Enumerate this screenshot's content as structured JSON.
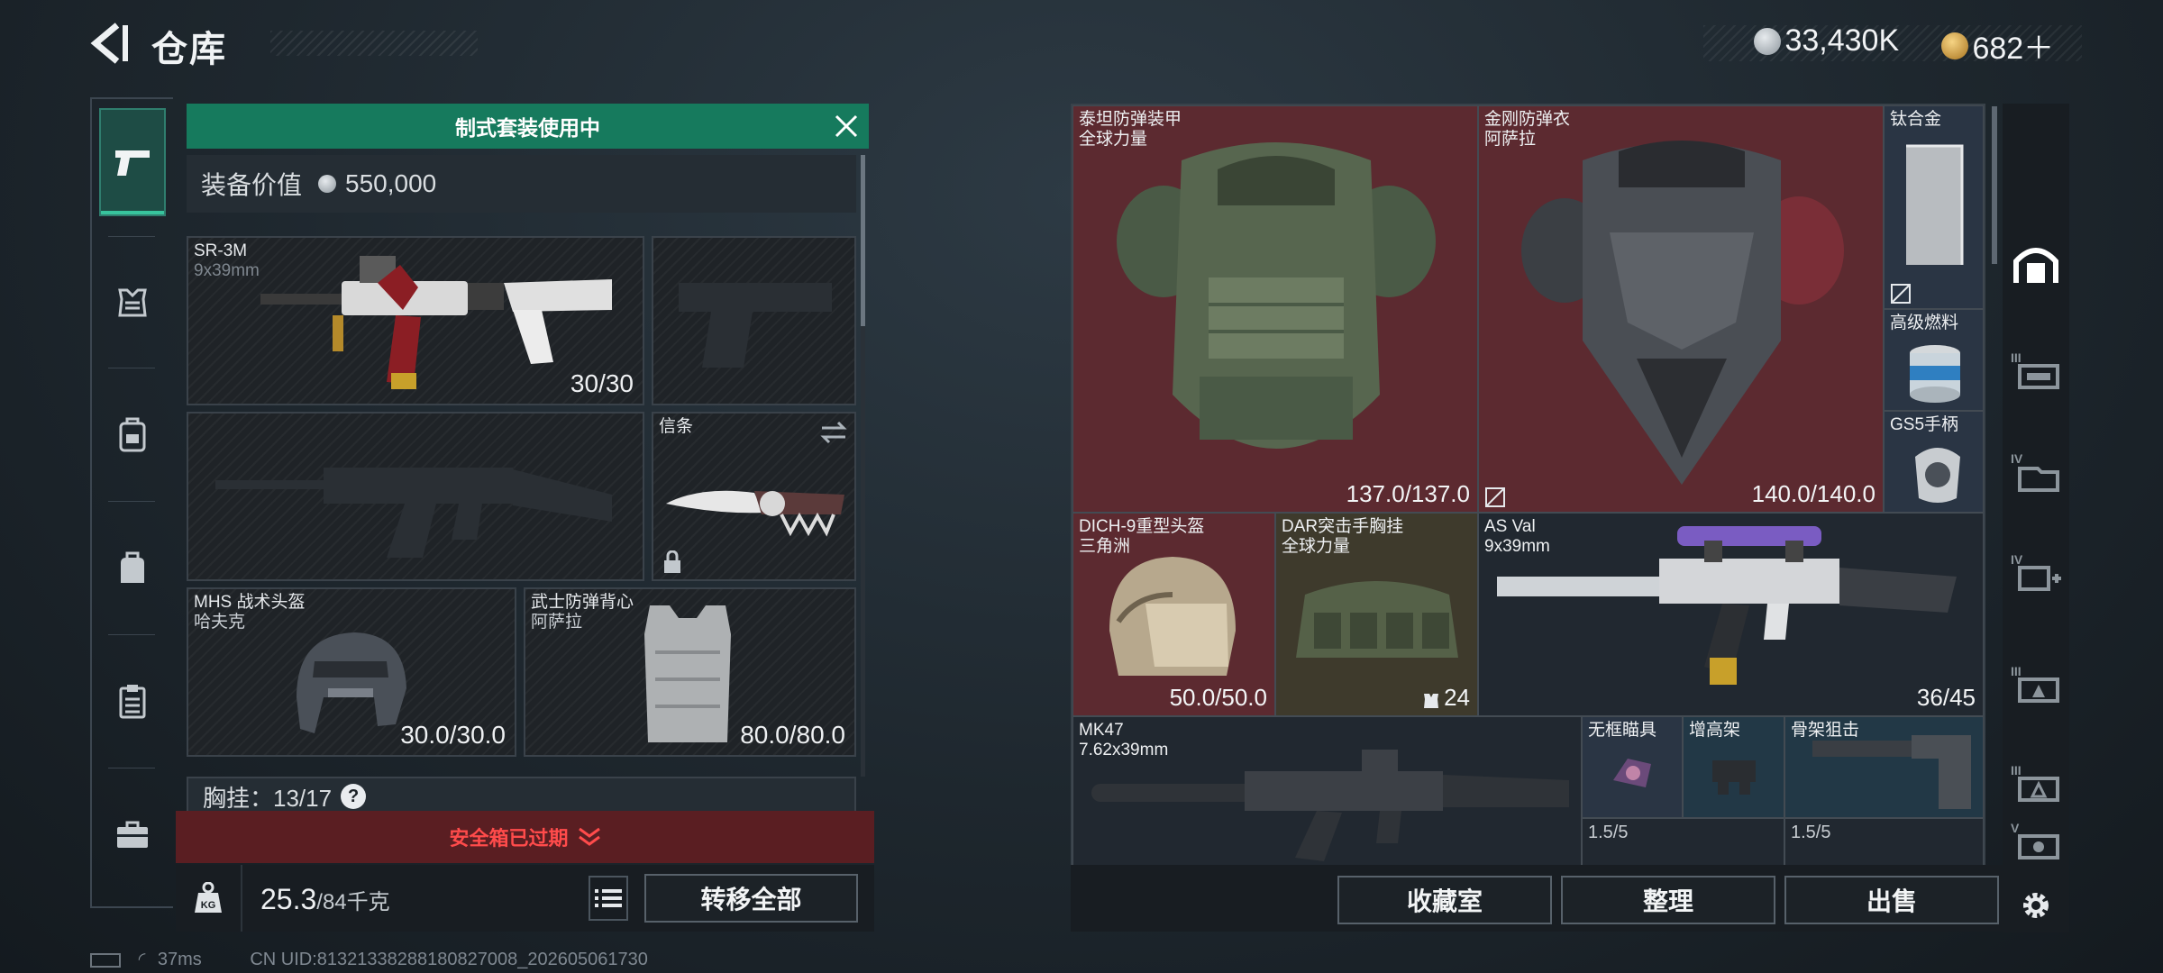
{
  "header": {
    "title": "仓库",
    "currency": [
      {
        "icon": "silver-coin-icon",
        "amount": "33,430K",
        "color": "#b9c0c6"
      },
      {
        "icon": "gold-coin-icon",
        "amount": "682＋",
        "color": "#d7a24a"
      }
    ]
  },
  "left_tabs": [
    {
      "icon": "pistol-icon"
    },
    {
      "icon": "armor-icon"
    },
    {
      "icon": "backpack-icon"
    },
    {
      "icon": "bag-icon"
    },
    {
      "icon": "clipboard-icon"
    },
    {
      "icon": "briefcase-icon"
    }
  ],
  "loadout": {
    "banner": "制式套装使用中",
    "value_label": "装备价值",
    "value": "550,000",
    "primary": {
      "name": "SR-3M",
      "ammo": "9x39mm",
      "count": "30/30"
    },
    "melee": {
      "name": "信条"
    },
    "helmet": {
      "name": "MHS 战术头盔",
      "brand": "哈夫克",
      "durability": "30.0/30.0"
    },
    "armor": {
      "name": "武士防弹背心",
      "brand": "阿萨拉",
      "durability": "80.0/80.0"
    },
    "chest_rig": "胸挂：13/17",
    "chest_help": "?",
    "safe_box": "安全箱已过期",
    "weight": "25.3",
    "weight_max": "/84千克",
    "transfer_all": "转移全部"
  },
  "stash": {
    "items": [
      {
        "name": "泰坦防弹装甲",
        "brand": "全球力量",
        "value": "137.0/137.0"
      },
      {
        "name": "金刚防弹衣",
        "brand": "阿萨拉",
        "value": "140.0/140.0"
      },
      {
        "name": "钛合金"
      },
      {
        "name": "高级燃料"
      },
      {
        "name": "GS5手柄"
      },
      {
        "name": "DICH-9重型头盔",
        "brand": "三角洲",
        "value": "50.0/50.0"
      },
      {
        "name": "DAR突击手胸挂",
        "brand": "全球力量",
        "value": "24"
      },
      {
        "name": "AS Val",
        "brand": "9x39mm",
        "value": "36/45"
      },
      {
        "name": "MK47",
        "brand": "7.62x39mm"
      },
      {
        "name": "无框瞄具",
        "value": "1.5/5"
      },
      {
        "name": "增高架"
      },
      {
        "name": "骨架狙击",
        "value": "1.5/5"
      }
    ],
    "buttons": {
      "collection": "收藏室",
      "organize": "整理",
      "sell": "出售"
    }
  },
  "right_tabs": [
    {
      "icon": "stash-home-icon",
      "roman": ""
    },
    {
      "icon": "shelf-iii-icon",
      "roman": "III"
    },
    {
      "icon": "shelf-iv-icon",
      "roman": "IV"
    },
    {
      "icon": "shelf-iv-plus-icon",
      "roman": "IV"
    },
    {
      "icon": "shelf-iii-triangle-icon",
      "roman": "III"
    },
    {
      "icon": "shelf-iii-triangle-2-icon",
      "roman": "III"
    },
    {
      "icon": "shelf-v-icon",
      "roman": "V"
    }
  ],
  "status": {
    "ping": "37ms",
    "uid": "CN UID:8132133828818082700​8_202605061730"
  }
}
